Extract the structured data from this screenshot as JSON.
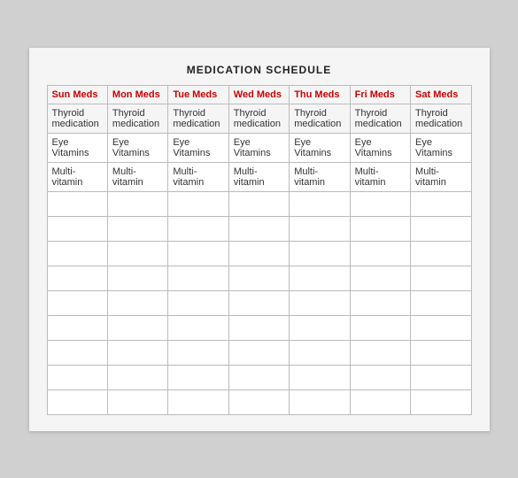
{
  "title": "MEDICATION SCHEDULE",
  "columns": [
    {
      "label": "Sun Meds",
      "key": "sun"
    },
    {
      "label": "Mon Meds",
      "key": "mon"
    },
    {
      "label": "Tue Meds",
      "key": "tue"
    },
    {
      "label": "Wed Meds",
      "key": "wed"
    },
    {
      "label": "Thu Meds",
      "key": "thu"
    },
    {
      "label": "Fri Meds",
      "key": "fri"
    },
    {
      "label": "Sat Meds",
      "key": "sat"
    }
  ],
  "rows": [
    {
      "sun": "Thyroid medication",
      "mon": "Thyroid medication",
      "tue": "Thyroid medication",
      "wed": "Thyroid medication",
      "thu": "Thyroid medication",
      "fri": "Thyroid medication",
      "sat": "Thyroid medication"
    },
    {
      "sun": "Eye Vitamins",
      "mon": "Eye Vitamins",
      "tue": "Eye Vitamins",
      "wed": "Eye Vitamins",
      "thu": "Eye Vitamins",
      "fri": "Eye Vitamins",
      "sat": "Eye Vitamins"
    },
    {
      "sun": "Multi-vitamin",
      "mon": "Multi-vitamin",
      "tue": "Multi-vitamin",
      "wed": "Multi-vitamin",
      "thu": "Multi-vitamin",
      "fri": "Multi-vitamin",
      "sat": "Multi-vitamin"
    }
  ],
  "empty_rows": 9
}
